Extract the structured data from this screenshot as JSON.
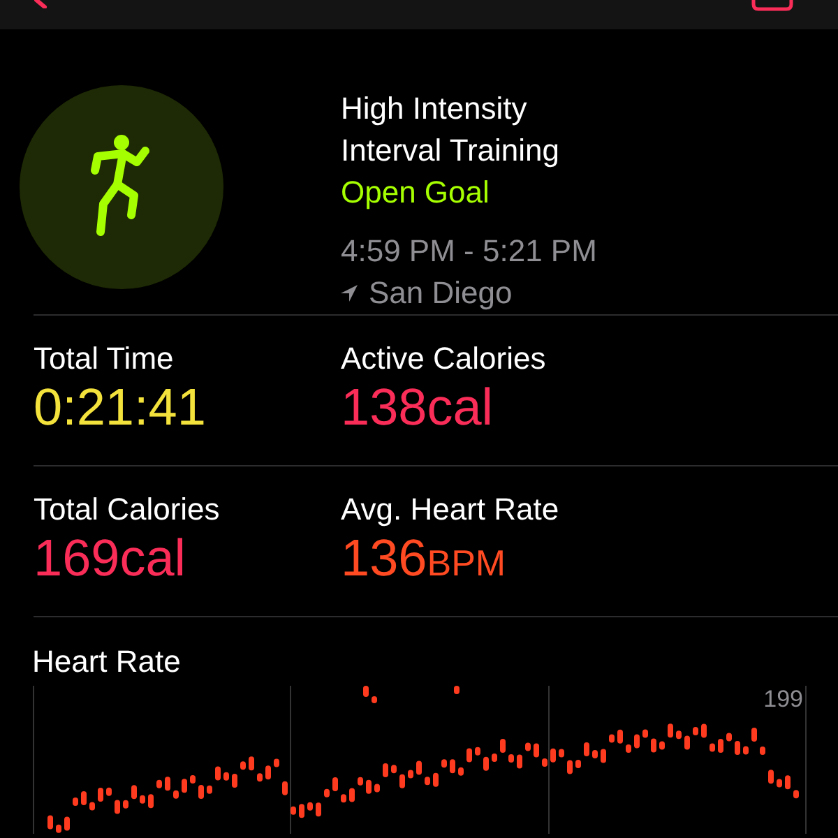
{
  "workout": {
    "title_lines": [
      "High Intensity",
      "Interval Training"
    ],
    "goal": "Open Goal",
    "time_range": "4:59 PM - 5:21 PM",
    "location": "San Diego"
  },
  "stats": [
    {
      "label": "Total Time",
      "value": "0:21:41",
      "color": "#f4e23c"
    },
    {
      "label": "Active Calories",
      "value": "138cal",
      "color": "#fa2d58"
    },
    {
      "label": "Total Calories",
      "value": "169cal",
      "color": "#fa2d58"
    },
    {
      "label": "Avg. Heart Rate",
      "value": "136",
      "unit": "BPM",
      "color": "#ff4a22"
    }
  ],
  "heart_rate": {
    "title": "Heart Rate",
    "top_tick": "199"
  }
}
